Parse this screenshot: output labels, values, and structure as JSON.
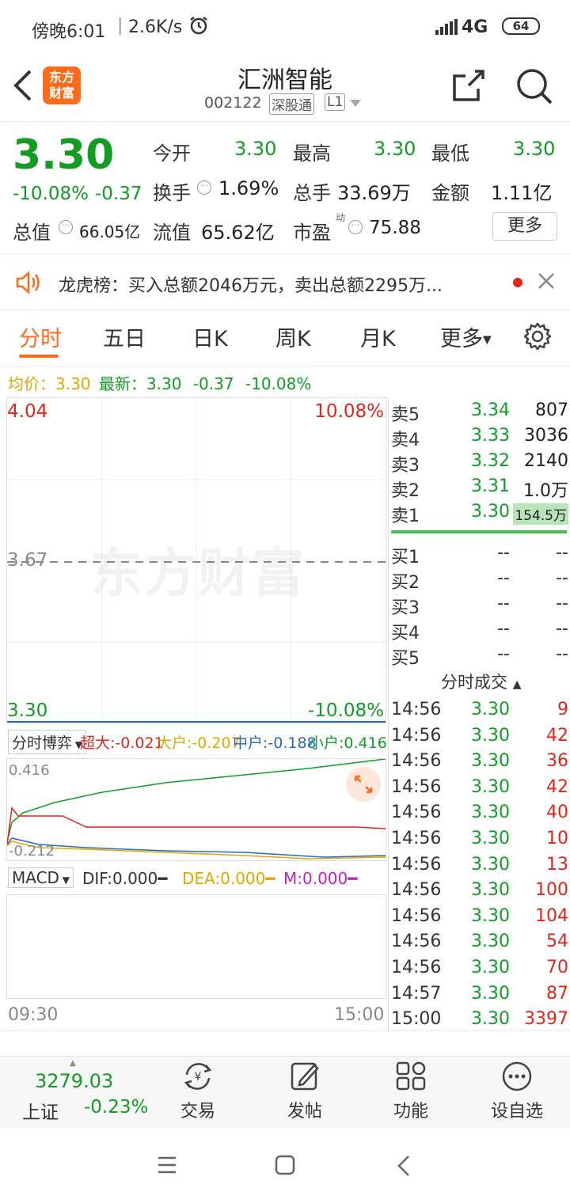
{
  "status": {
    "time": "傍晚6:01",
    "speed": "2.6K/s",
    "network": "4G",
    "battery": "64"
  },
  "header": {
    "logo_line1": "东方",
    "logo_line2": "财富",
    "stock_name": "汇洲智能",
    "stock_code": "002122",
    "tag_connect": "深股通",
    "tag_level": "L1"
  },
  "quote": {
    "price": "3.30",
    "change_pct": "-10.08%",
    "change": "-0.37",
    "open_label": "今开",
    "open": "3.30",
    "high_label": "最高",
    "high": "3.30",
    "low_label": "最低",
    "low": "3.30",
    "turnover_label": "换手",
    "turnover": "1.69%",
    "volume_label": "总手",
    "volume": "33.69万",
    "amount_label": "金额",
    "amount": "1.11亿",
    "mcap_label": "总值",
    "mcap": "66.05亿",
    "float_label": "流值",
    "float": "65.62亿",
    "pe_label": "市盈",
    "pe_sup": "动",
    "pe": "75.88",
    "more": "更多"
  },
  "notice": {
    "text": "龙虎榜：买入总额2046万元，卖出总额2295万..."
  },
  "tabs": [
    "分时",
    "五日",
    "日K",
    "周K",
    "月K",
    "更多"
  ],
  "info_line": {
    "avg_label": "均价：",
    "avg": "3.30",
    "latest_label": "最新：",
    "latest": "3.30",
    "chg": "-0.37",
    "pct": "-10.08%"
  },
  "chart": {
    "y_top": "4.04",
    "pct_top": "10.08%",
    "y_mid": "3.67",
    "y_bot": "3.30",
    "pct_bot": "-10.08%",
    "watermark": "东方财富",
    "time_start": "09:30",
    "time_end": "15:00"
  },
  "flow": {
    "selector": "分时博弈",
    "super_label": "超大:",
    "super": "-0.021",
    "big_label": "大户:",
    "big": "-0.207",
    "mid_label": "中户:",
    "mid": "-0.188",
    "small_label": "小户:",
    "small": "0.416",
    "y_top": "0.416",
    "y_bot": "-0.212"
  },
  "macd": {
    "selector": "MACD",
    "dif": "DIF:0.000",
    "dea": "DEA:0.000",
    "m": "M:0.000"
  },
  "orderbook": {
    "sells": [
      {
        "label": "卖5",
        "price": "3.34",
        "vol": "807"
      },
      {
        "label": "卖4",
        "price": "3.33",
        "vol": "3036"
      },
      {
        "label": "卖3",
        "price": "3.32",
        "vol": "2140"
      },
      {
        "label": "卖2",
        "price": "3.31",
        "vol": "1.0万"
      },
      {
        "label": "卖1",
        "price": "3.30",
        "vol": "154.5万"
      }
    ],
    "buys": [
      {
        "label": "买1",
        "price": "--",
        "vol": "--"
      },
      {
        "label": "买2",
        "price": "--",
        "vol": "--"
      },
      {
        "label": "买3",
        "price": "--",
        "vol": "--"
      },
      {
        "label": "买4",
        "price": "--",
        "vol": "--"
      },
      {
        "label": "买5",
        "price": "--",
        "vol": "--"
      }
    ],
    "trades_title": "分时成交",
    "trades": [
      {
        "time": "14:56",
        "price": "3.30",
        "vol": "9"
      },
      {
        "time": "14:56",
        "price": "3.30",
        "vol": "42"
      },
      {
        "time": "14:56",
        "price": "3.30",
        "vol": "36"
      },
      {
        "time": "14:56",
        "price": "3.30",
        "vol": "42"
      },
      {
        "time": "14:56",
        "price": "3.30",
        "vol": "40"
      },
      {
        "time": "14:56",
        "price": "3.30",
        "vol": "10"
      },
      {
        "time": "14:56",
        "price": "3.30",
        "vol": "13"
      },
      {
        "time": "14:56",
        "price": "3.30",
        "vol": "100"
      },
      {
        "time": "14:56",
        "price": "3.30",
        "vol": "104"
      },
      {
        "time": "14:56",
        "price": "3.30",
        "vol": "54"
      },
      {
        "time": "14:56",
        "price": "3.30",
        "vol": "70"
      },
      {
        "time": "14:57",
        "price": "3.30",
        "vol": "87"
      },
      {
        "time": "15:00",
        "price": "3.30",
        "vol": "3397"
      }
    ]
  },
  "bottom": {
    "index_value": "3279.03",
    "index_name": "上证",
    "index_pct": "-0.23%",
    "trade": "交易",
    "post": "发帖",
    "func": "功能",
    "watch": "设自选"
  },
  "colors": {
    "up": "#e1251b",
    "down": "#109d22",
    "brand": "#ff6a1b",
    "avg": "#e0a800"
  }
}
